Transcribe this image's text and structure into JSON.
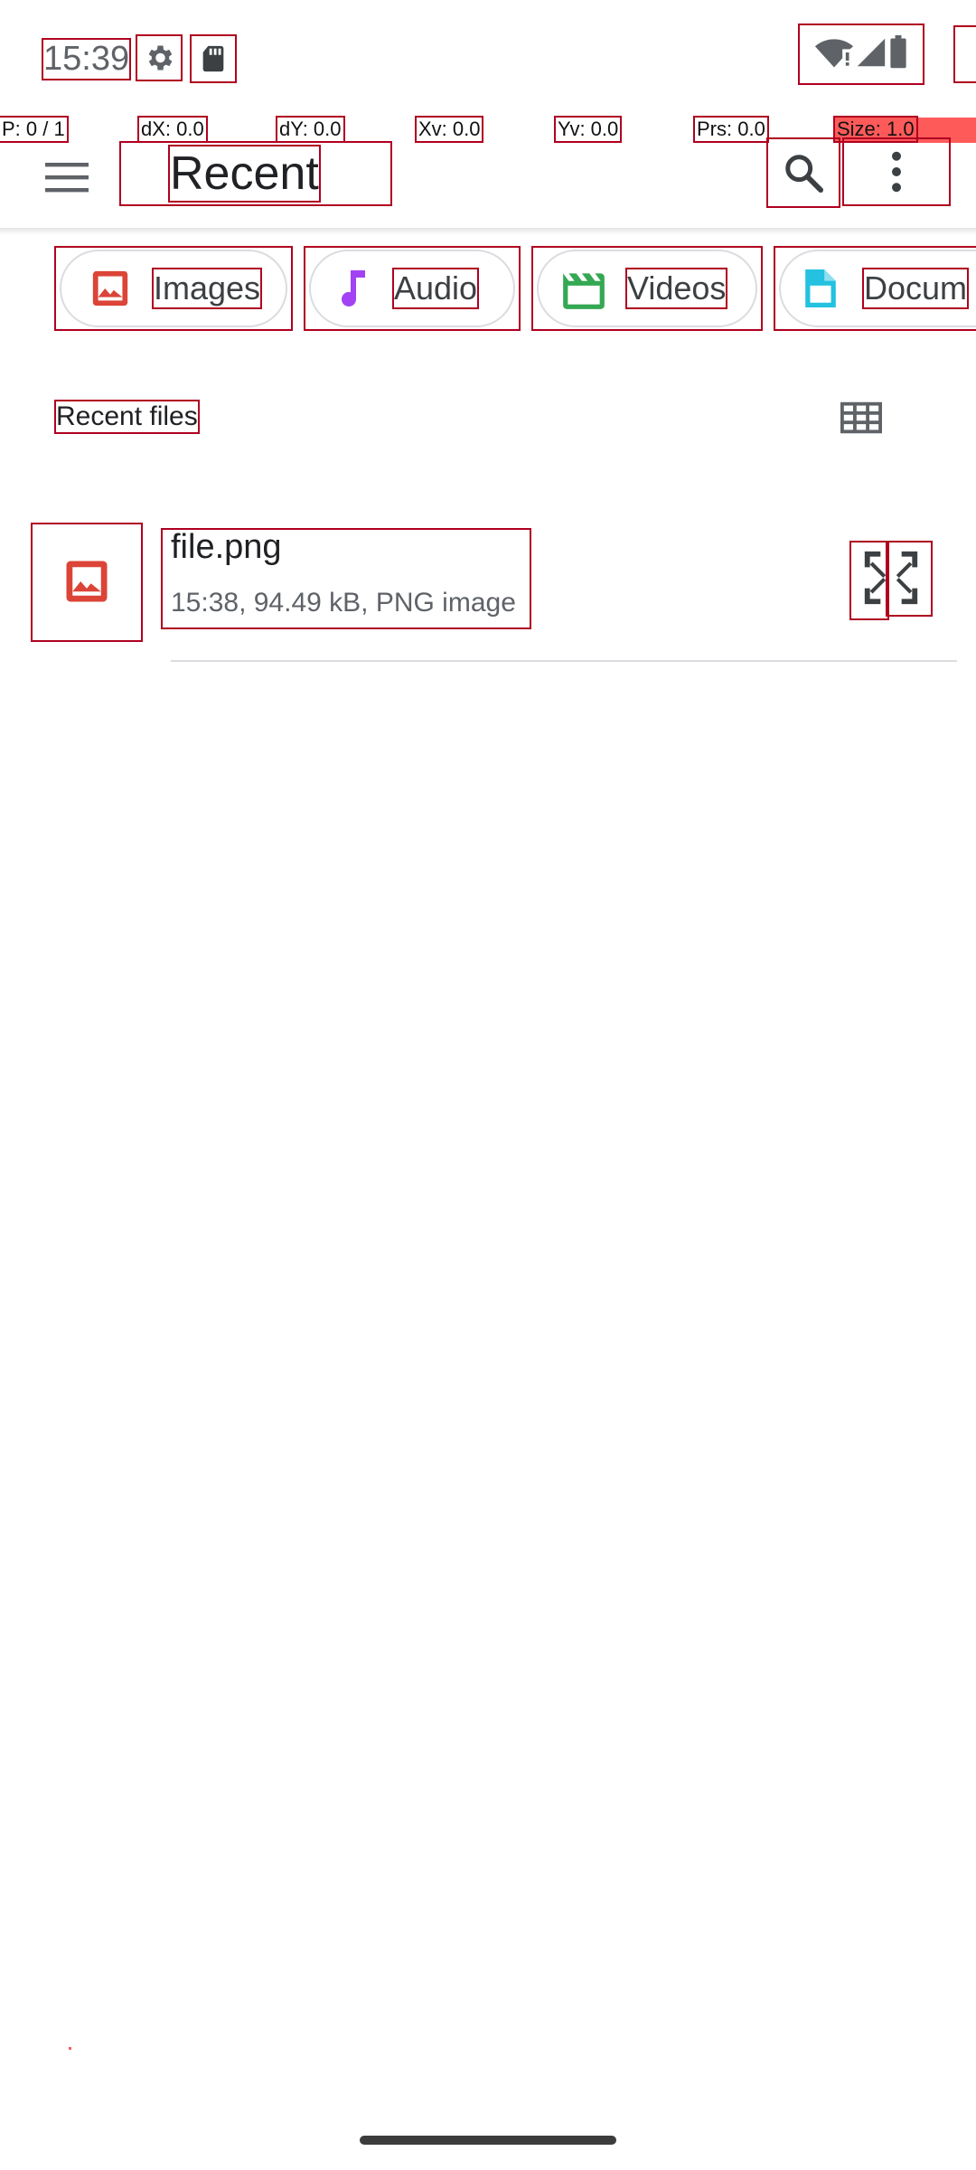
{
  "status_bar": {
    "time": "15:39",
    "icons": [
      "settings-gear-icon",
      "sd-card-icon",
      "wifi-alert-icon",
      "cellular-signal-icon",
      "battery-icon"
    ]
  },
  "overlay": {
    "pointer": "P: 0 / 1",
    "dx": "dX: 0.0",
    "dy": "dY: 0.0",
    "xv": "Xv: 0.0",
    "yv": "Yv: 0.0",
    "prs": "Prs: 0.0",
    "size": "Size: 1.0"
  },
  "appbar": {
    "title": "Recent",
    "icons": [
      "menu-icon",
      "search-icon",
      "more-vert-icon"
    ]
  },
  "chips": [
    {
      "label": "Images",
      "icon": "image-icon",
      "color": "#db4437"
    },
    {
      "label": "Audio",
      "icon": "music-note-icon",
      "color": "#a142f4"
    },
    {
      "label": "Videos",
      "icon": "video-clapper-icon",
      "color": "#34a853"
    },
    {
      "label": "Docum",
      "icon": "document-icon",
      "color": "#24c1e0"
    }
  ],
  "section": {
    "title": "Recent files",
    "view_toggle_icon": "grid-view-icon"
  },
  "files": [
    {
      "name": "file.png",
      "meta": "15:38, 94.49 kB, PNG image",
      "thumb_icon": "image-icon",
      "thumb_color": "#db4437",
      "action_icon": "expand-icon"
    }
  ],
  "colors": {
    "accent_red": "#db4437",
    "outline": "#b00020",
    "overlay_red": "#ff5a5a"
  }
}
